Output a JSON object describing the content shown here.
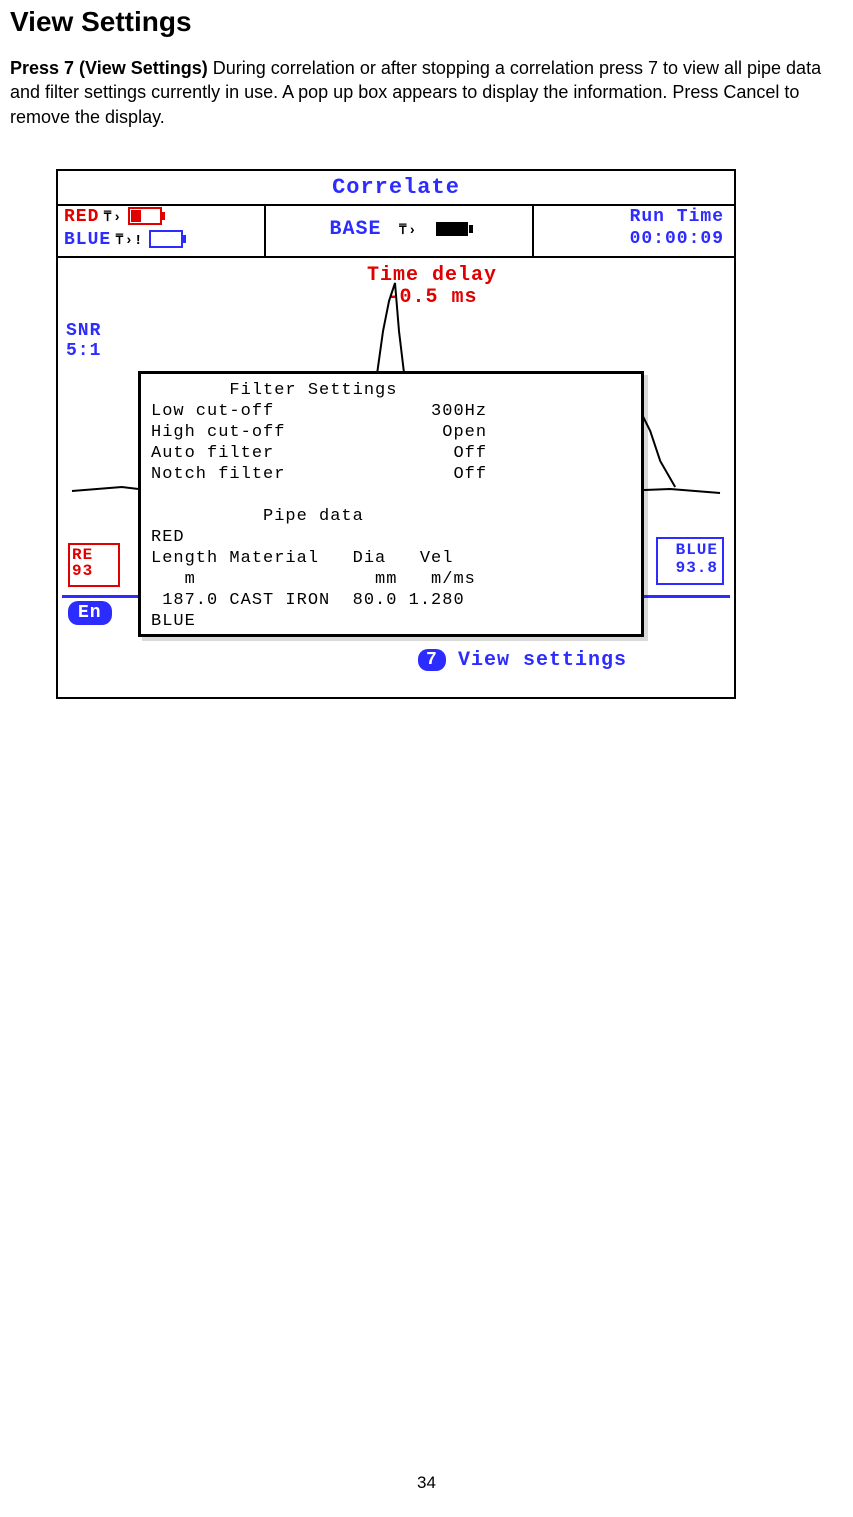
{
  "doc": {
    "section_title": "View Settings",
    "para_bold": "Press 7 (View Settings)",
    "para_rest": " During correlation or after stopping a correlation press 7 to view all pipe data and filter settings currently in use. A pop up box appears to display the information. Press Cancel to remove the display.",
    "page_number": "34"
  },
  "screen": {
    "title": "Correlate",
    "red_label": "RED",
    "blue_label": "BLUE",
    "base_label": "BASE",
    "runtime_label": "Run Time",
    "runtime_value": "00:00:09",
    "snr_label": "SNR",
    "snr_value": "5:1",
    "timedelay_label": "Time delay",
    "timedelay_value": "-0.5 ms",
    "red_box_top": "RE",
    "red_box_bot": "93",
    "blue_box_top": "BLUE",
    "blue_box_bot": "93.8",
    "en_pill": "En",
    "seven_pill": "7",
    "view_settings_label": "View settings"
  },
  "popup": {
    "filter_title": "Filter Settings",
    "low_cut_label": "Low cut-off",
    "low_cut_value": "300Hz",
    "high_cut_label": "High cut-off",
    "high_cut_value": "Open",
    "auto_filter_label": "Auto filter",
    "auto_filter_value": "Off",
    "notch_filter_label": "Notch filter",
    "notch_filter_value": "Off",
    "pipe_title": "Pipe data",
    "pipe_red": "RED",
    "pipe_headers": "Length Material   Dia   Vel",
    "pipe_units": "   m                mm   m/ms",
    "pipe_row": " 187.0 CAST IRON  80.0 1.280",
    "pipe_blue": "BLUE"
  }
}
